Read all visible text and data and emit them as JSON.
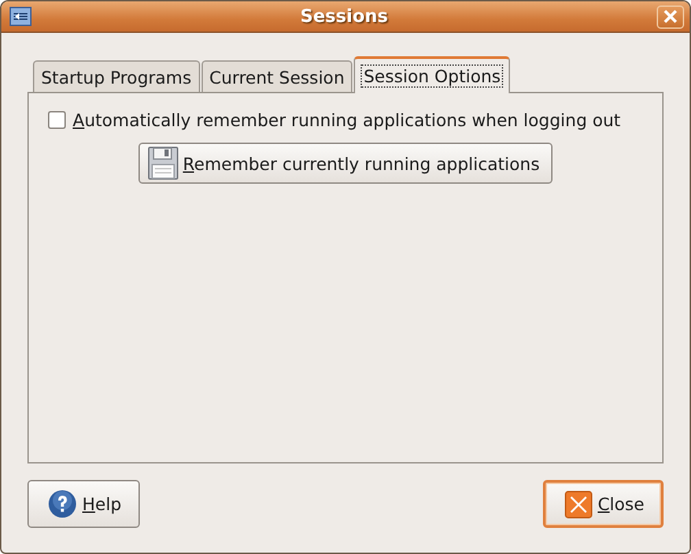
{
  "window": {
    "title": "Sessions"
  },
  "tabs": [
    {
      "label": "Startup Programs",
      "selected": false
    },
    {
      "label": "Current Session",
      "selected": false
    },
    {
      "label": "Session Options",
      "selected": true
    }
  ],
  "options": {
    "checkbox": {
      "label": "Automatically remember running applications when logging out",
      "checked": false,
      "mnemonic": true
    },
    "button": {
      "label": "Remember currently running applications",
      "mnemonic": true
    }
  },
  "buttons": [
    {
      "label": "Help",
      "kind": "help",
      "mnemonic": true,
      "default": false
    },
    {
      "label": "Close",
      "kind": "close",
      "mnemonic": true,
      "default": true
    }
  ]
}
